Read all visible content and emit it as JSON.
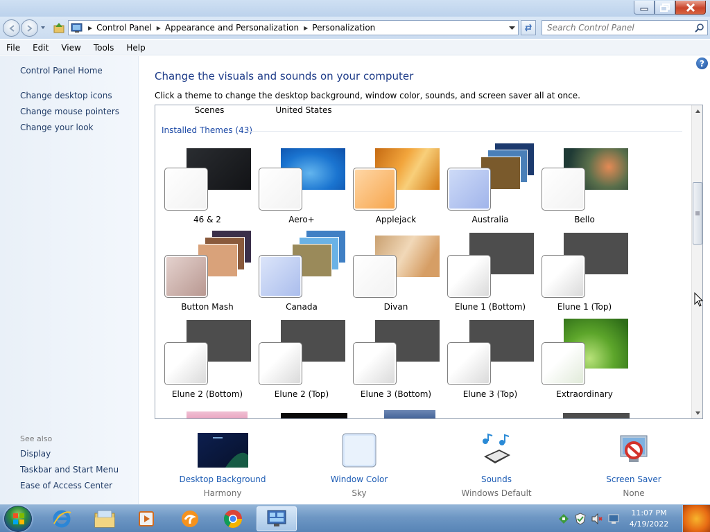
{
  "window": {
    "caption_buttons": [
      "minimize-icon",
      "restore-icon",
      "close-icon"
    ]
  },
  "address": {
    "breadcrumbs": [
      "Control Panel",
      "Appearance and Personalization",
      "Personalization"
    ],
    "search_placeholder": "Search Control Panel"
  },
  "menu": [
    "File",
    "Edit",
    "View",
    "Tools",
    "Help"
  ],
  "left": {
    "home": "Control Panel Home",
    "tasks": [
      "Change desktop icons",
      "Change mouse pointers",
      "Change your look"
    ],
    "see_also_label": "See also",
    "see_also": [
      "Display",
      "Taskbar and Start Menu",
      "Ease of Access Center"
    ]
  },
  "main": {
    "title": "Change the visuals and sounds on your computer",
    "subtitle": "Click a theme to change the desktop background, window color, sounds, and screen saver all at once.",
    "top_labels": [
      "Scenes",
      "United States"
    ],
    "group_header": "Installed Themes (43)",
    "themes": [
      {
        "name": "46 & 2",
        "bg": "dark"
      },
      {
        "name": "Aero+",
        "bg": "aero"
      },
      {
        "name": "Applejack",
        "bg": "apple"
      },
      {
        "name": "Australia",
        "bg": "stack-blue"
      },
      {
        "name": "Bello",
        "bg": "bello"
      },
      {
        "name": "Button Mash",
        "bg": "stack-warm"
      },
      {
        "name": "Canada",
        "bg": "stack-sky"
      },
      {
        "name": "Divan",
        "bg": "divan"
      },
      {
        "name": "Elune 1 (Bottom)",
        "bg": "gray"
      },
      {
        "name": "Elune 1 (Top)",
        "bg": "gray"
      },
      {
        "name": "Elune 2 (Bottom)",
        "bg": "gray"
      },
      {
        "name": "Elune 2 (Top)",
        "bg": "gray"
      },
      {
        "name": "Elune 3 (Bottom)",
        "bg": "gray"
      },
      {
        "name": "Elune 3 (Top)",
        "bg": "gray"
      },
      {
        "name": "Extraordinary",
        "bg": "extra"
      }
    ]
  },
  "quick_links": [
    {
      "label": "Desktop Background",
      "value": "Harmony",
      "icon": "desktop-background-icon"
    },
    {
      "label": "Window Color",
      "value": "Sky",
      "icon": "window-color-icon"
    },
    {
      "label": "Sounds",
      "value": "Windows Default",
      "icon": "sounds-icon"
    },
    {
      "label": "Screen Saver",
      "value": "None",
      "icon": "screen-saver-icon"
    }
  ],
  "taskbar": {
    "pinned": [
      "internet-explorer-icon",
      "windows-explorer-icon",
      "media-player-icon",
      "uc-browser-icon",
      "chrome-icon",
      "control-panel-icon"
    ],
    "time": "11:07 PM",
    "date": "4/19/2022"
  },
  "colors": {
    "link": "#1e3a66",
    "heading": "#1d3b88",
    "taskbar": "#6e97c4"
  }
}
